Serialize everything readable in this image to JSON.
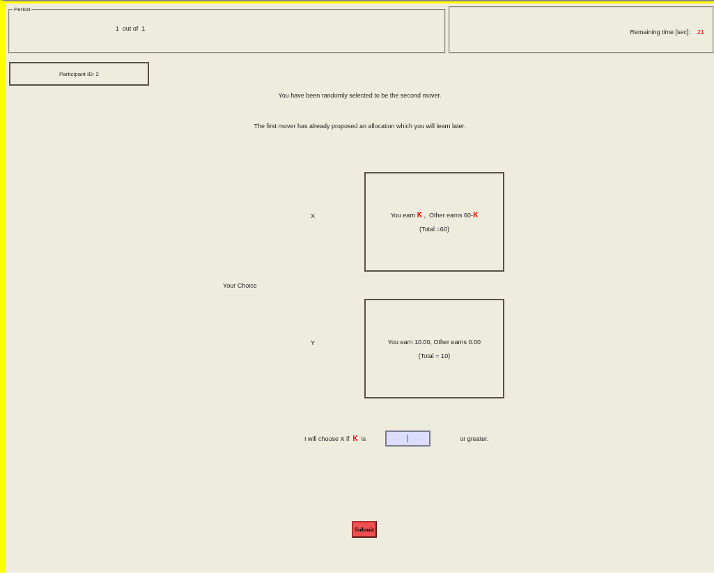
{
  "period": {
    "legend": "Period",
    "current": "1",
    "separator": "out of",
    "total": "1"
  },
  "timer": {
    "label": "Remaining time [sec]:",
    "value": "21"
  },
  "participant": {
    "label": "Participant ID: 2"
  },
  "messages": [
    "You have been randomly selected to be the second mover.",
    "The first mover has already proposed an allocation which you will learn later."
  ],
  "choice": {
    "label": "Your Choice",
    "options": [
      {
        "letter": "X",
        "lines": [
          [
            {
              "kind": "plain",
              "text": "You earn "
            },
            {
              "kind": "var",
              "text": "K"
            },
            {
              "kind": "plain",
              "text": " ,  Other earns 60-"
            },
            {
              "kind": "var",
              "text": "K"
            }
          ],
          [
            {
              "kind": "plain",
              "text": "(Total =60)"
            }
          ]
        ]
      },
      {
        "letter": "Y",
        "lines": [
          [
            {
              "kind": "plain",
              "text": "You earn 10.00, Other earns 0.00"
            }
          ],
          [
            {
              "kind": "plain",
              "text": "(Total = 10)"
            }
          ]
        ]
      }
    ]
  },
  "threshold": {
    "prompt": [
      {
        "kind": "plain",
        "text": "I will choose X if  "
      },
      {
        "kind": "var",
        "text": "K"
      },
      {
        "kind": "plain",
        "text": "  is"
      }
    ],
    "suffix": "or greater."
  },
  "submit": {
    "label": "Submit"
  }
}
